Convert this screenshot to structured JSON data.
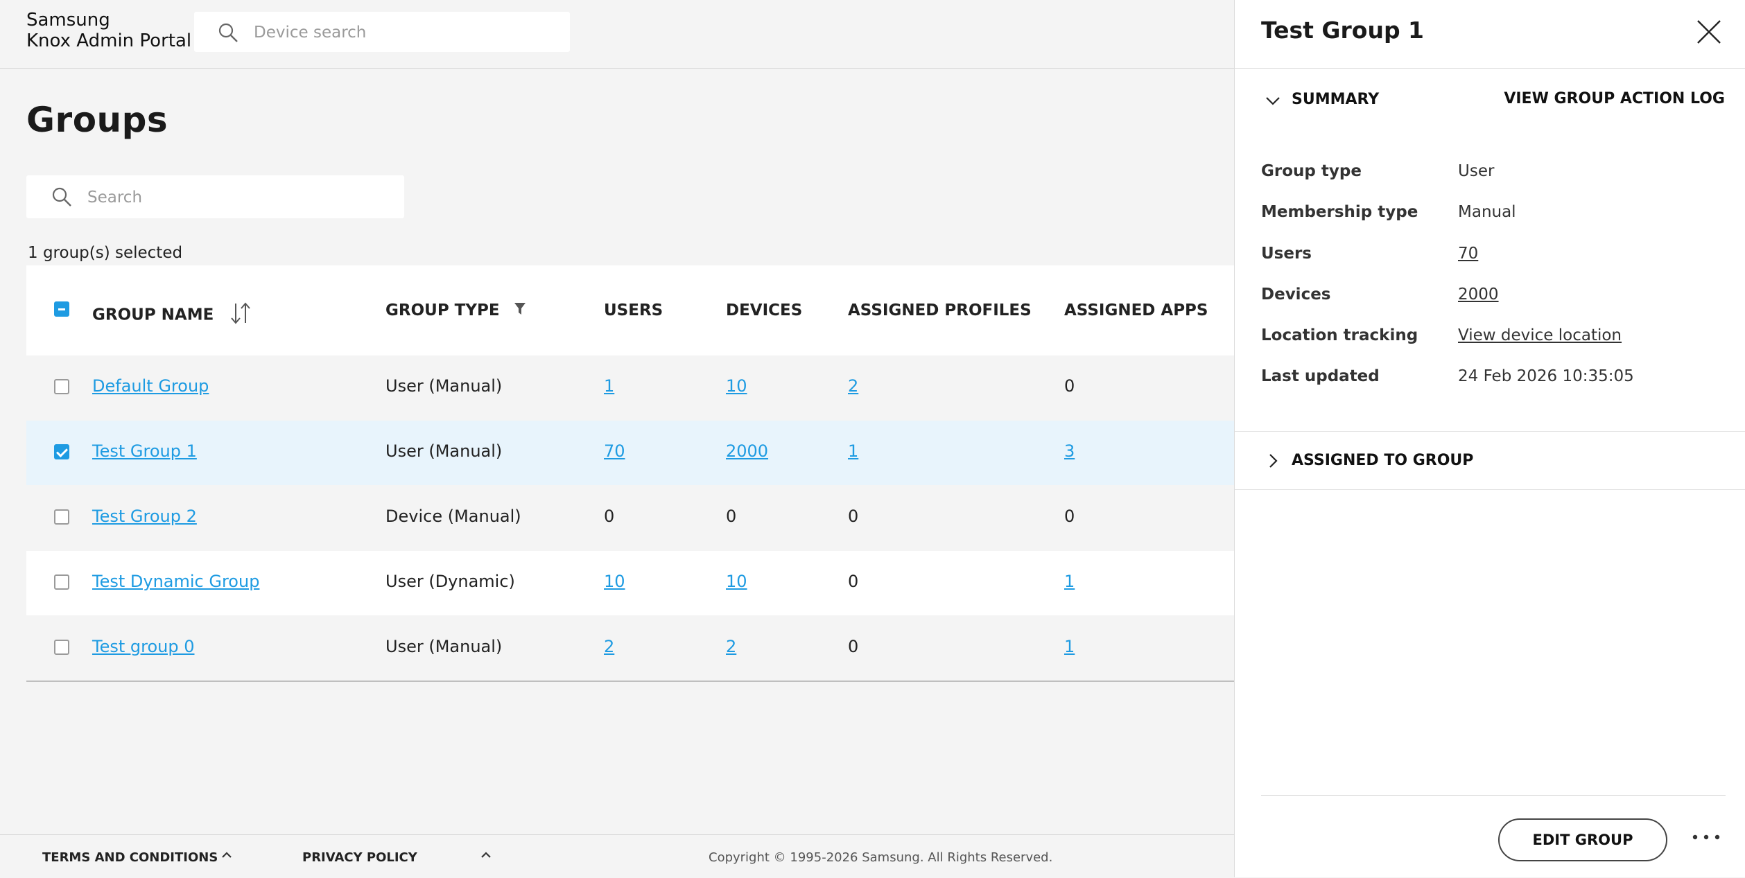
{
  "header": {
    "brand_line1": "Samsung",
    "brand_line2": "Knox Admin Portal",
    "device_search_placeholder": "Device search"
  },
  "page": {
    "title": "Groups",
    "search_placeholder": "Search",
    "selected_count": "1 group(s) selected"
  },
  "table": {
    "columns": [
      "GROUP NAME",
      "GROUP TYPE",
      "USERS",
      "DEVICES",
      "ASSIGNED PROFILES",
      "ASSIGNED APPS"
    ],
    "rows": [
      {
        "name": "Default Group",
        "type": "User (Manual)",
        "users": "1",
        "devices": "10",
        "profiles": "2",
        "apps": "0",
        "checked": false
      },
      {
        "name": "Test Group 1",
        "type": "User (Manual)",
        "users": "70",
        "devices": "2000",
        "profiles": "1",
        "apps": "3",
        "checked": true
      },
      {
        "name": "Test Group 2",
        "type": "Device (Manual)",
        "users": "0",
        "devices": "0",
        "profiles": "0",
        "apps": "0",
        "checked": false
      },
      {
        "name": "Test Dynamic Group",
        "type": "User (Dynamic)",
        "users": "10",
        "devices": "10",
        "profiles": "0",
        "apps": "1",
        "checked": false
      },
      {
        "name": "Test group 0",
        "type": "User (Manual)",
        "users": "2",
        "devices": "2",
        "profiles": "0",
        "apps": "1",
        "checked": false
      }
    ]
  },
  "footer": {
    "terms": "TERMS AND CONDITIONS",
    "privacy": "PRIVACY POLICY",
    "copyright": "Copyright © 1995-2026 Samsung. All Rights Reserved."
  },
  "panel": {
    "title": "Test Group 1",
    "summary_label": "SUMMARY",
    "action_log_label": "VIEW GROUP ACTION LOG",
    "details": [
      {
        "label": "Group type",
        "value": "User",
        "link": false
      },
      {
        "label": "Membership type",
        "value": "Manual",
        "link": false
      },
      {
        "label": "Users",
        "value": "70",
        "link": true
      },
      {
        "label": "Devices",
        "value": "2000",
        "link": true
      },
      {
        "label": "Location tracking",
        "value": "View device location",
        "link": true
      },
      {
        "label": "Last updated",
        "value": "24 Feb 2026 10:35:05",
        "link": false
      }
    ],
    "assigned_label": "ASSIGNED TO GROUP",
    "edit_button": "EDIT GROUP"
  },
  "colors": {
    "accent": "#1e9be2",
    "selected_row": "#e8f4fc",
    "background": "#f4f4f4"
  }
}
